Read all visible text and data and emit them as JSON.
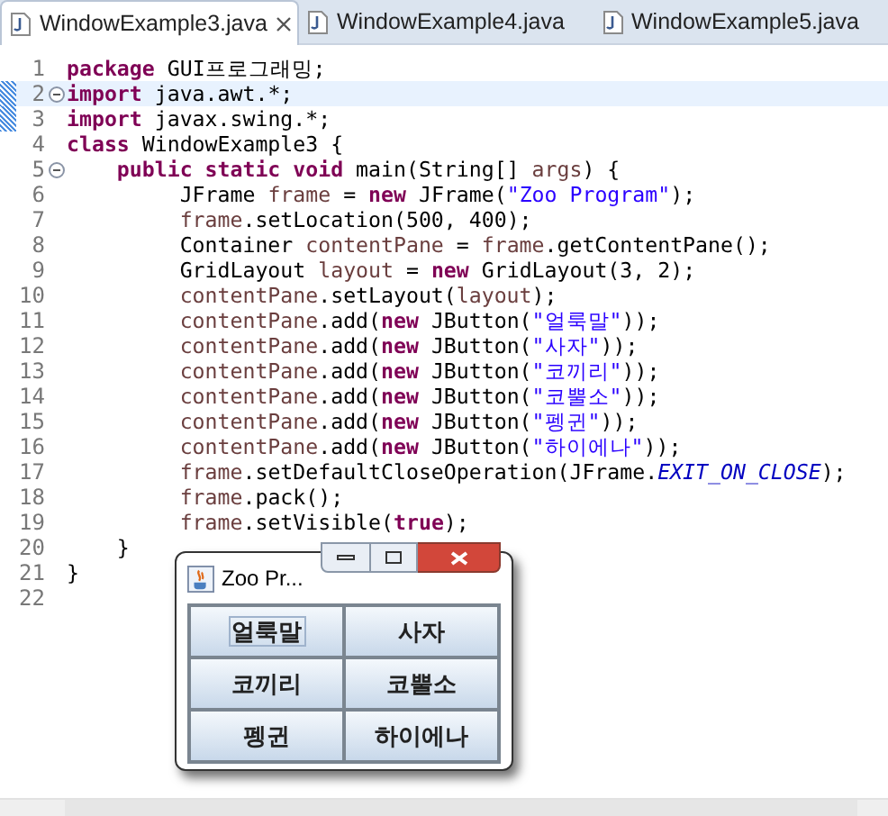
{
  "tabs": [
    {
      "label": "WindowExample3.java",
      "selected": true
    },
    {
      "label": "WindowExample4.java",
      "selected": false
    },
    {
      "label": "WindowExample5.java",
      "selected": false
    }
  ],
  "editor": {
    "lines": [
      {
        "number": "1",
        "fold": false,
        "current": false,
        "marked": false,
        "tokens": [
          {
            "kind": "k",
            "text": "package"
          },
          {
            "kind": "t",
            "text": " GUI프로그래밍;"
          }
        ]
      },
      {
        "number": "2",
        "fold": true,
        "current": true,
        "marked": true,
        "tokens": [
          {
            "kind": "k",
            "text": "import"
          },
          {
            "kind": "t",
            "text": " java.awt.*;"
          }
        ]
      },
      {
        "number": "3",
        "fold": false,
        "current": false,
        "marked": true,
        "tokens": [
          {
            "kind": "k",
            "text": "import"
          },
          {
            "kind": "t",
            "text": " javax.swing.*;"
          }
        ]
      },
      {
        "number": "4",
        "fold": false,
        "current": false,
        "marked": false,
        "tokens": [
          {
            "kind": "k",
            "text": "class"
          },
          {
            "kind": "t",
            "text": " WindowExample3 {"
          }
        ]
      },
      {
        "number": "5",
        "fold": true,
        "current": false,
        "marked": false,
        "tokens": [
          {
            "kind": "k",
            "text": "    public static void"
          },
          {
            "kind": "t",
            "text": " main(String[] "
          },
          {
            "kind": "v",
            "text": "args"
          },
          {
            "kind": "t",
            "text": ") {"
          }
        ]
      },
      {
        "number": "6",
        "fold": false,
        "current": false,
        "marked": false,
        "tokens": [
          {
            "kind": "t",
            "text": "         JFrame "
          },
          {
            "kind": "v",
            "text": "frame"
          },
          {
            "kind": "t",
            "text": " = "
          },
          {
            "kind": "k",
            "text": "new"
          },
          {
            "kind": "t",
            "text": " JFrame("
          },
          {
            "kind": "s",
            "text": "\"Zoo Program\""
          },
          {
            "kind": "t",
            "text": ");"
          }
        ]
      },
      {
        "number": "7",
        "fold": false,
        "current": false,
        "marked": false,
        "tokens": [
          {
            "kind": "v",
            "text": "         frame"
          },
          {
            "kind": "t",
            "text": ".setLocation(500, 400);"
          }
        ]
      },
      {
        "number": "8",
        "fold": false,
        "current": false,
        "marked": false,
        "tokens": [
          {
            "kind": "t",
            "text": "         Container "
          },
          {
            "kind": "v",
            "text": "contentPane"
          },
          {
            "kind": "t",
            "text": " = "
          },
          {
            "kind": "v",
            "text": "frame"
          },
          {
            "kind": "t",
            "text": ".getContentPane();"
          }
        ]
      },
      {
        "number": "9",
        "fold": false,
        "current": false,
        "marked": false,
        "tokens": [
          {
            "kind": "t",
            "text": "         GridLayout "
          },
          {
            "kind": "v",
            "text": "layout"
          },
          {
            "kind": "t",
            "text": " = "
          },
          {
            "kind": "k",
            "text": "new"
          },
          {
            "kind": "t",
            "text": " GridLayout(3, 2);"
          }
        ]
      },
      {
        "number": "10",
        "fold": false,
        "current": false,
        "marked": false,
        "tokens": [
          {
            "kind": "v",
            "text": "         contentPane"
          },
          {
            "kind": "t",
            "text": ".setLayout("
          },
          {
            "kind": "v",
            "text": "layout"
          },
          {
            "kind": "t",
            "text": ");"
          }
        ]
      },
      {
        "number": "11",
        "fold": false,
        "current": false,
        "marked": false,
        "tokens": [
          {
            "kind": "v",
            "text": "         contentPane"
          },
          {
            "kind": "t",
            "text": ".add("
          },
          {
            "kind": "k",
            "text": "new"
          },
          {
            "kind": "t",
            "text": " JButton("
          },
          {
            "kind": "s",
            "text": "\"얼룩말\""
          },
          {
            "kind": "t",
            "text": "));"
          }
        ]
      },
      {
        "number": "12",
        "fold": false,
        "current": false,
        "marked": false,
        "tokens": [
          {
            "kind": "v",
            "text": "         contentPane"
          },
          {
            "kind": "t",
            "text": ".add("
          },
          {
            "kind": "k",
            "text": "new"
          },
          {
            "kind": "t",
            "text": " JButton("
          },
          {
            "kind": "s",
            "text": "\"사자\""
          },
          {
            "kind": "t",
            "text": "));"
          }
        ]
      },
      {
        "number": "13",
        "fold": false,
        "current": false,
        "marked": false,
        "tokens": [
          {
            "kind": "v",
            "text": "         contentPane"
          },
          {
            "kind": "t",
            "text": ".add("
          },
          {
            "kind": "k",
            "text": "new"
          },
          {
            "kind": "t",
            "text": " JButton("
          },
          {
            "kind": "s",
            "text": "\"코끼리\""
          },
          {
            "kind": "t",
            "text": "));"
          }
        ]
      },
      {
        "number": "14",
        "fold": false,
        "current": false,
        "marked": false,
        "tokens": [
          {
            "kind": "v",
            "text": "         contentPane"
          },
          {
            "kind": "t",
            "text": ".add("
          },
          {
            "kind": "k",
            "text": "new"
          },
          {
            "kind": "t",
            "text": " JButton("
          },
          {
            "kind": "s",
            "text": "\"코뿔소\""
          },
          {
            "kind": "t",
            "text": "));"
          }
        ]
      },
      {
        "number": "15",
        "fold": false,
        "current": false,
        "marked": false,
        "tokens": [
          {
            "kind": "v",
            "text": "         contentPane"
          },
          {
            "kind": "t",
            "text": ".add("
          },
          {
            "kind": "k",
            "text": "new"
          },
          {
            "kind": "t",
            "text": " JButton("
          },
          {
            "kind": "s",
            "text": "\"펭귄\""
          },
          {
            "kind": "t",
            "text": "));"
          }
        ]
      },
      {
        "number": "16",
        "fold": false,
        "current": false,
        "marked": false,
        "tokens": [
          {
            "kind": "v",
            "text": "         contentPane"
          },
          {
            "kind": "t",
            "text": ".add("
          },
          {
            "kind": "k",
            "text": "new"
          },
          {
            "kind": "t",
            "text": " JButton("
          },
          {
            "kind": "s",
            "text": "\"하이에나\""
          },
          {
            "kind": "t",
            "text": "));"
          }
        ]
      },
      {
        "number": "17",
        "fold": false,
        "current": false,
        "marked": false,
        "tokens": [
          {
            "kind": "v",
            "text": "         frame"
          },
          {
            "kind": "t",
            "text": ".setDefaultCloseOperation(JFrame."
          },
          {
            "kind": "c",
            "text": "EXIT_ON_CLOSE"
          },
          {
            "kind": "t",
            "text": ");"
          }
        ]
      },
      {
        "number": "18",
        "fold": false,
        "current": false,
        "marked": false,
        "tokens": [
          {
            "kind": "v",
            "text": "         frame"
          },
          {
            "kind": "t",
            "text": ".pack();"
          }
        ]
      },
      {
        "number": "19",
        "fold": false,
        "current": false,
        "marked": false,
        "tokens": [
          {
            "kind": "v",
            "text": "         frame"
          },
          {
            "kind": "t",
            "text": ".setVisible("
          },
          {
            "kind": "k",
            "text": "true"
          },
          {
            "kind": "t",
            "text": ");"
          }
        ]
      },
      {
        "number": "20",
        "fold": false,
        "current": false,
        "marked": false,
        "tokens": [
          {
            "kind": "t",
            "text": "    }"
          }
        ]
      },
      {
        "number": "21",
        "fold": false,
        "current": false,
        "marked": false,
        "tokens": [
          {
            "kind": "t",
            "text": "}"
          }
        ]
      },
      {
        "number": "22",
        "fold": false,
        "current": false,
        "marked": false
      }
    ]
  },
  "window": {
    "title": "Zoo Pr...",
    "buttons": [
      {
        "label": "얼룩말",
        "focused": true
      },
      {
        "label": "사자",
        "focused": false
      },
      {
        "label": "코끼리",
        "focused": false
      },
      {
        "label": "코뿔소",
        "focused": false
      },
      {
        "label": "펭귄",
        "focused": false
      },
      {
        "label": "하이에나",
        "focused": false
      }
    ]
  }
}
